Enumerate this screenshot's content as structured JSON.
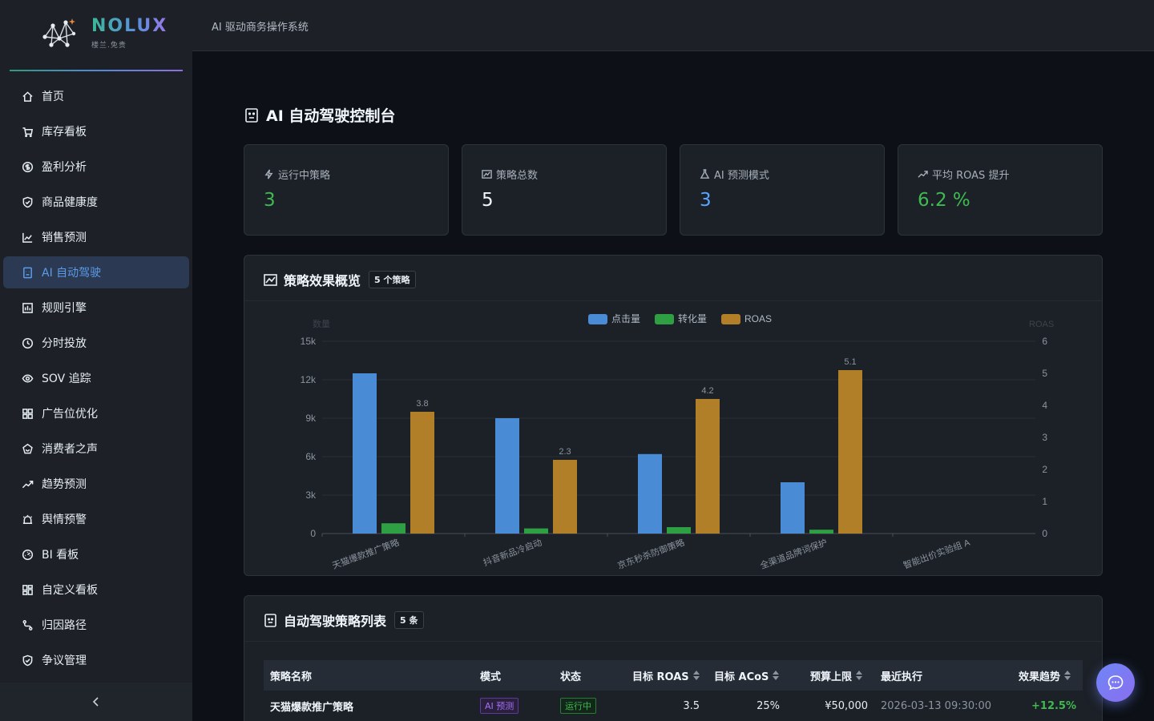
{
  "brand": {
    "name": "NOLUX",
    "sub": "楼兰.免贵"
  },
  "topbar": {
    "title": "AI 驱动商务操作系统"
  },
  "sidebar": {
    "items": [
      {
        "label": "首页",
        "icon": "home-icon",
        "active": false
      },
      {
        "label": "库存看板",
        "icon": "cart-icon",
        "active": false
      },
      {
        "label": "盈利分析",
        "icon": "dollar-circle-icon",
        "active": false
      },
      {
        "label": "商品健康度",
        "icon": "shield-check-icon",
        "active": false
      },
      {
        "label": "销售预测",
        "icon": "line-chart-icon",
        "active": false
      },
      {
        "label": "AI 自动驾驶",
        "icon": "robot-icon",
        "active": true
      },
      {
        "label": "规则引擎",
        "icon": "rules-icon",
        "active": false
      },
      {
        "label": "分时投放",
        "icon": "clock-icon",
        "active": false
      },
      {
        "label": "SOV 追踪",
        "icon": "eye-icon",
        "active": false
      },
      {
        "label": "广告位优化",
        "icon": "grid-icon",
        "active": false
      },
      {
        "label": "消费者之声",
        "icon": "megaphone-icon",
        "active": false
      },
      {
        "label": "趋势预测",
        "icon": "trend-icon",
        "active": false
      },
      {
        "label": "舆情预警",
        "icon": "alarm-icon",
        "active": false
      },
      {
        "label": "BI 看板",
        "icon": "dashboard-icon",
        "active": false
      },
      {
        "label": "自定义看板",
        "icon": "layout-icon",
        "active": false
      },
      {
        "label": "归因路径",
        "icon": "path-icon",
        "active": false
      },
      {
        "label": "争议管理",
        "icon": "shield-icon",
        "active": false
      }
    ]
  },
  "page": {
    "title": "AI 自动驾驶控制台"
  },
  "stats": [
    {
      "label": "运行中策略",
      "value": "3",
      "icon": "bolt-icon",
      "color": "#3fb950"
    },
    {
      "label": "策略总数",
      "value": "5",
      "icon": "area-chart-icon",
      "color": "#f0f6fc"
    },
    {
      "label": "AI 预测模式",
      "value": "3",
      "icon": "flask-icon",
      "color": "#58a6ff"
    },
    {
      "label": "平均 ROAS 提升",
      "value": "6.2 %",
      "icon": "rise-icon",
      "color": "#3fb950"
    }
  ],
  "overview": {
    "title": "策略效果概览",
    "tag": "5 个策略"
  },
  "chart_data": {
    "type": "bar",
    "categories": [
      "天猫爆款推广策略",
      "抖音新品冷启动",
      "京东秒杀防御策略",
      "全渠道品牌词保护",
      "智能出价实验组 A"
    ],
    "series": [
      {
        "name": "点击量",
        "axis": "left",
        "color": "#4a8bd6",
        "values": [
          12500,
          9000,
          6200,
          4000,
          0
        ]
      },
      {
        "name": "转化量",
        "axis": "left",
        "color": "#2ea043",
        "values": [
          800,
          400,
          500,
          300,
          0
        ]
      },
      {
        "name": "ROAS",
        "axis": "right",
        "color": "#b07f27",
        "values": [
          3.8,
          2.3,
          4.2,
          5.1,
          0
        ],
        "labels": [
          "3.8",
          "2.3",
          "4.2",
          "5.1",
          ""
        ]
      }
    ],
    "ylabel": "数量",
    "y2label": "ROAS",
    "ylim": [
      0,
      15000
    ],
    "y2lim": [
      0,
      6
    ],
    "yticks": [
      "0",
      "3k",
      "6k",
      "9k",
      "12k",
      "15k"
    ],
    "y2ticks": [
      "0",
      "1",
      "2",
      "3",
      "4",
      "5",
      "6"
    ],
    "legend": "top-center"
  },
  "table": {
    "title": "自动驾驶策略列表",
    "tag": "5 条",
    "columns": [
      "策略名称",
      "模式",
      "状态",
      "目标 ROAS",
      "目标 ACoS",
      "预算上限",
      "最近执行",
      "效果趋势"
    ],
    "rows": [
      {
        "name": "天猫爆款推广策略",
        "mode": "AI 预测",
        "status": "运行中",
        "roas": "3.5",
        "acos": "25%",
        "budget": "¥50,000",
        "last": "2026-03-13 09:30:00",
        "trend": "+12.5%"
      }
    ]
  }
}
